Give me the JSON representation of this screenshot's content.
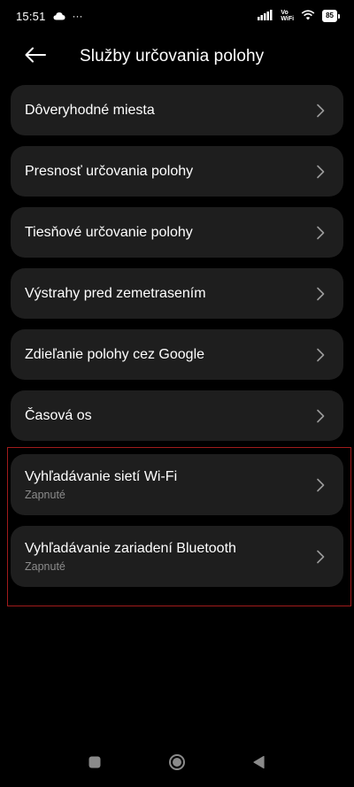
{
  "status_bar": {
    "time": "15:51",
    "extra_dots": "···",
    "vowifi_top": "Vo",
    "vowifi_bottom": "WiFi",
    "battery": "85"
  },
  "header": {
    "title": "Služby určovania polohy"
  },
  "items": [
    {
      "title": "Dôveryhodné miesta"
    },
    {
      "title": "Presnosť určovania polohy"
    },
    {
      "title": "Tiesňové určovanie polohy"
    },
    {
      "title": "Výstrahy pred zemetrasením"
    },
    {
      "title": "Zdieľanie polohy cez Google"
    },
    {
      "title": "Časová os"
    },
    {
      "title": "Vyhľadávanie sietí Wi-Fi",
      "subtitle": "Zapnuté"
    },
    {
      "title": "Vyhľadávanie zariadení Bluetooth",
      "subtitle": "Zapnuté"
    }
  ],
  "icons": {
    "back": "arrow-left-icon",
    "chevron": "chevron-right-icon",
    "cloud": "cloud-icon",
    "signal": "signal-icon",
    "wifi": "wifi-icon",
    "nav_recent": "square-icon",
    "nav_home": "circle-icon",
    "nav_back": "triangle-icon"
  },
  "colors": {
    "background": "#000000",
    "card": "#1e1e1e",
    "subtitle": "#8c8c8c",
    "highlight": "#a11b1b"
  }
}
